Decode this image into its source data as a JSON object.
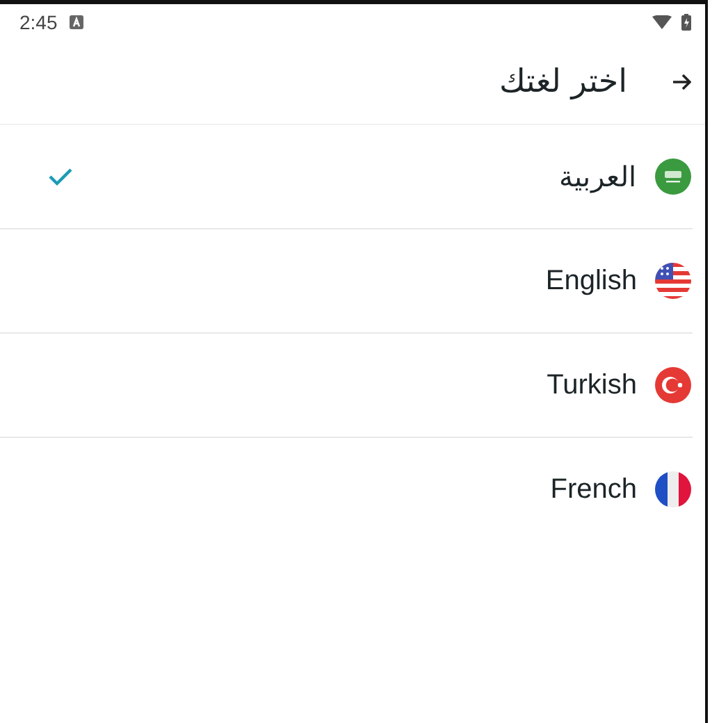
{
  "status_bar": {
    "time": "2:45"
  },
  "header": {
    "title": "اختر لغتك"
  },
  "languages": [
    {
      "label": "العربية",
      "kind": "sa",
      "selected": true
    },
    {
      "label": "English",
      "kind": "us",
      "selected": false
    },
    {
      "label": "Turkish",
      "kind": "tr",
      "selected": false
    },
    {
      "label": "French",
      "kind": "fr",
      "selected": false
    }
  ]
}
